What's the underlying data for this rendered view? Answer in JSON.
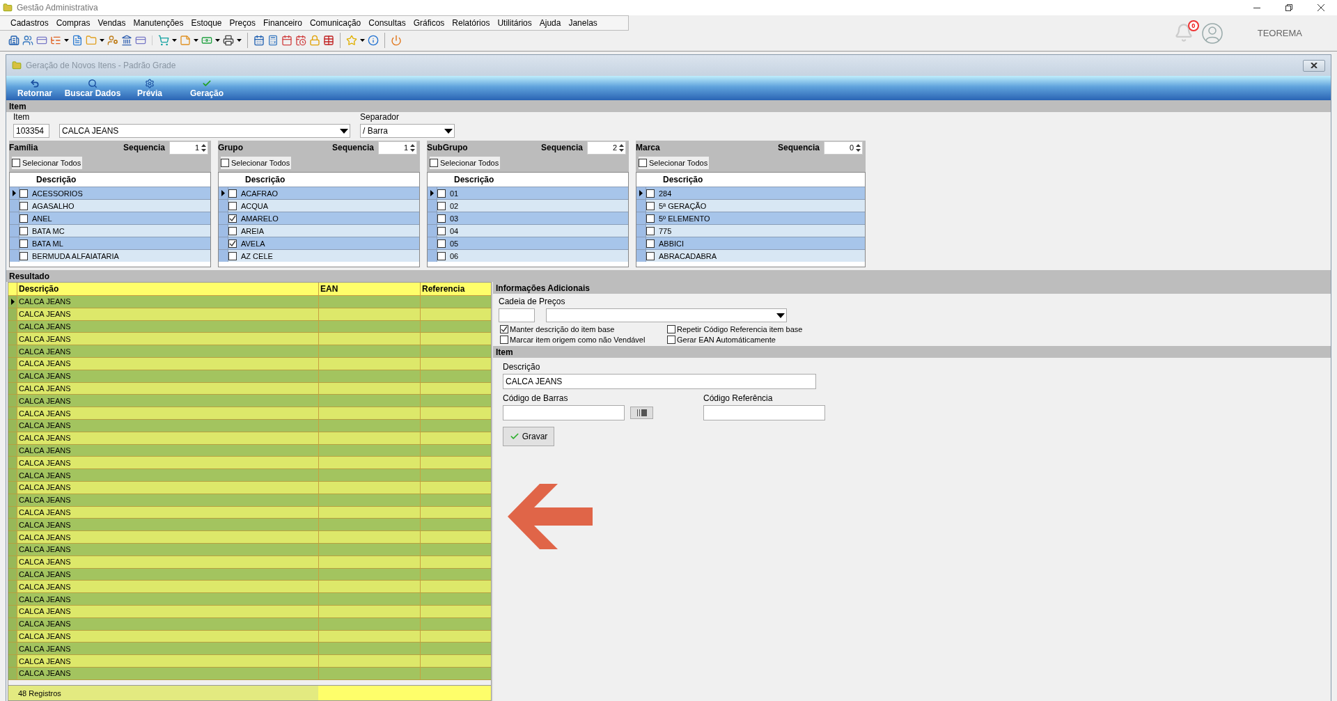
{
  "app_title": "Gestão Administrativa",
  "menu": [
    "Cadastros",
    "Compras",
    "Vendas",
    "Manutenções",
    "Estoque",
    "Preços",
    "Financeiro",
    "Comunicação",
    "Consultas",
    "Gráficos",
    "Relatórios",
    "Utilitários",
    "Ajuda",
    "Janelas"
  ],
  "notifications": {
    "count": "0"
  },
  "user": "TEOREMA",
  "window": {
    "title": "Geração de Novos Itens - Padrão Grade",
    "actions": [
      {
        "kind": "back",
        "label": "Retornar"
      },
      {
        "kind": "search",
        "label": "Buscar Dados"
      },
      {
        "kind": "gear",
        "label": "Prévia"
      },
      {
        "kind": "check",
        "label": "Geração"
      }
    ]
  },
  "item_section": {
    "header": "Item",
    "item_label": "Item",
    "code": "103354",
    "description": "CALCA JEANS",
    "separator_label": "Separador",
    "separator": "/ Barra"
  },
  "filters": [
    {
      "title": "Família",
      "sequence_label": "Sequencia",
      "sequence": "1",
      "select_all": {
        "label": "Selecionar Todos",
        "checked": false
      },
      "column": "Descrição",
      "rows": [
        {
          "text": "ACESSORIOS",
          "checked": false,
          "selected": true
        },
        {
          "text": "AGASALHO",
          "checked": false,
          "selected": false
        },
        {
          "text": "ANEL",
          "checked": false,
          "selected": false
        },
        {
          "text": "BATA MC",
          "checked": false,
          "selected": false
        },
        {
          "text": "BATA ML",
          "checked": false,
          "selected": false
        },
        {
          "text": "BERMUDA ALFAIATARIA",
          "checked": false,
          "selected": false
        }
      ]
    },
    {
      "title": "Grupo",
      "sequence_label": "Sequencia",
      "sequence": "1",
      "select_all": {
        "label": "Selecionar Todos",
        "checked": false
      },
      "column": "Descrição",
      "rows": [
        {
          "text": "ACAFRAO",
          "checked": false,
          "selected": true
        },
        {
          "text": "ACQUA",
          "checked": false,
          "selected": false
        },
        {
          "text": "AMARELO",
          "checked": true,
          "selected": false
        },
        {
          "text": "AREIA",
          "checked": false,
          "selected": false
        },
        {
          "text": "AVELA",
          "checked": true,
          "selected": false
        },
        {
          "text": "AZ CELE",
          "checked": false,
          "selected": false
        }
      ]
    },
    {
      "title": "SubGrupo",
      "sequence_label": "Sequencia",
      "sequence": "2",
      "select_all": {
        "label": "Selecionar Todos",
        "checked": false
      },
      "column": "Descrição",
      "rows": [
        {
          "text": "01",
          "checked": false,
          "selected": true
        },
        {
          "text": "02",
          "checked": false,
          "selected": false
        },
        {
          "text": "03",
          "checked": false,
          "selected": false
        },
        {
          "text": "04",
          "checked": false,
          "selected": false
        },
        {
          "text": "05",
          "checked": false,
          "selected": false
        },
        {
          "text": "06",
          "checked": false,
          "selected": false
        }
      ]
    },
    {
      "title": "Marca",
      "sequence_label": "Sequencia",
      "sequence": "0",
      "select_all": {
        "label": "Selecionar Todos",
        "checked": false
      },
      "column": "Descrição",
      "rows": [
        {
          "text": "284",
          "checked": false,
          "selected": true
        },
        {
          "text": "5ª GERAÇÃO",
          "checked": false,
          "selected": false
        },
        {
          "text": "5º ELEMENTO",
          "checked": false,
          "selected": false
        },
        {
          "text": "775",
          "checked": false,
          "selected": false
        },
        {
          "text": "ABBICI",
          "checked": false,
          "selected": false
        },
        {
          "text": "ABRACADABRA",
          "checked": false,
          "selected": false
        }
      ]
    }
  ],
  "result": {
    "header": "Resultado",
    "columns": [
      "Descrição",
      "EAN",
      "Referencia"
    ],
    "rows": [
      {
        "description": "CALCA JEANS",
        "selected": true
      },
      {
        "description": "CALCA JEANS",
        "selected": false
      },
      {
        "description": "CALCA JEANS",
        "selected": false
      },
      {
        "description": "CALCA JEANS",
        "selected": false
      },
      {
        "description": "CALCA JEANS",
        "selected": false
      },
      {
        "description": "CALCA JEANS",
        "selected": false
      },
      {
        "description": "CALCA JEANS",
        "selected": false
      },
      {
        "description": "CALCA JEANS",
        "selected": false
      },
      {
        "description": "CALCA JEANS",
        "selected": false
      },
      {
        "description": "CALCA JEANS",
        "selected": false
      },
      {
        "description": "CALCA JEANS",
        "selected": false
      },
      {
        "description": "CALCA JEANS",
        "selected": false
      },
      {
        "description": "CALCA JEANS",
        "selected": false
      },
      {
        "description": "CALCA JEANS",
        "selected": false
      },
      {
        "description": "CALCA JEANS",
        "selected": false
      },
      {
        "description": "CALCA JEANS",
        "selected": false
      },
      {
        "description": "CALCA JEANS",
        "selected": false
      },
      {
        "description": "CALCA JEANS",
        "selected": false
      },
      {
        "description": "CALCA JEANS",
        "selected": false
      },
      {
        "description": "CALCA JEANS",
        "selected": false
      },
      {
        "description": "CALCA JEANS",
        "selected": false
      },
      {
        "description": "CALCA JEANS",
        "selected": false
      },
      {
        "description": "CALCA JEANS",
        "selected": false
      },
      {
        "description": "CALCA JEANS",
        "selected": false
      },
      {
        "description": "CALCA JEANS",
        "selected": false
      },
      {
        "description": "CALCA JEANS",
        "selected": false
      },
      {
        "description": "CALCA JEANS",
        "selected": false
      },
      {
        "description": "CALCA JEANS",
        "selected": false
      },
      {
        "description": "CALCA JEANS",
        "selected": false
      },
      {
        "description": "CALCA JEANS",
        "selected": false
      },
      {
        "description": "CALCA JEANS",
        "selected": false
      }
    ],
    "footer": "48 Registros"
  },
  "additional": {
    "header": "Informações Adicionais",
    "price_chain_label": "Cadeia de Preços",
    "options": [
      {
        "label": "Manter descrição do item base",
        "checked": true
      },
      {
        "label": "Repetir Código Referencia item base",
        "checked": false
      },
      {
        "label": "Marcar item origem como não Vendável",
        "checked": false
      },
      {
        "label": "Gerar EAN Automáticamente",
        "checked": false
      }
    ]
  },
  "item_form": {
    "header": "Item",
    "description_label": "Descrição",
    "description": "CALCA JEANS",
    "barcode_label": "Código de Barras",
    "reference_label": "Código Referência",
    "save": "Gravar"
  }
}
